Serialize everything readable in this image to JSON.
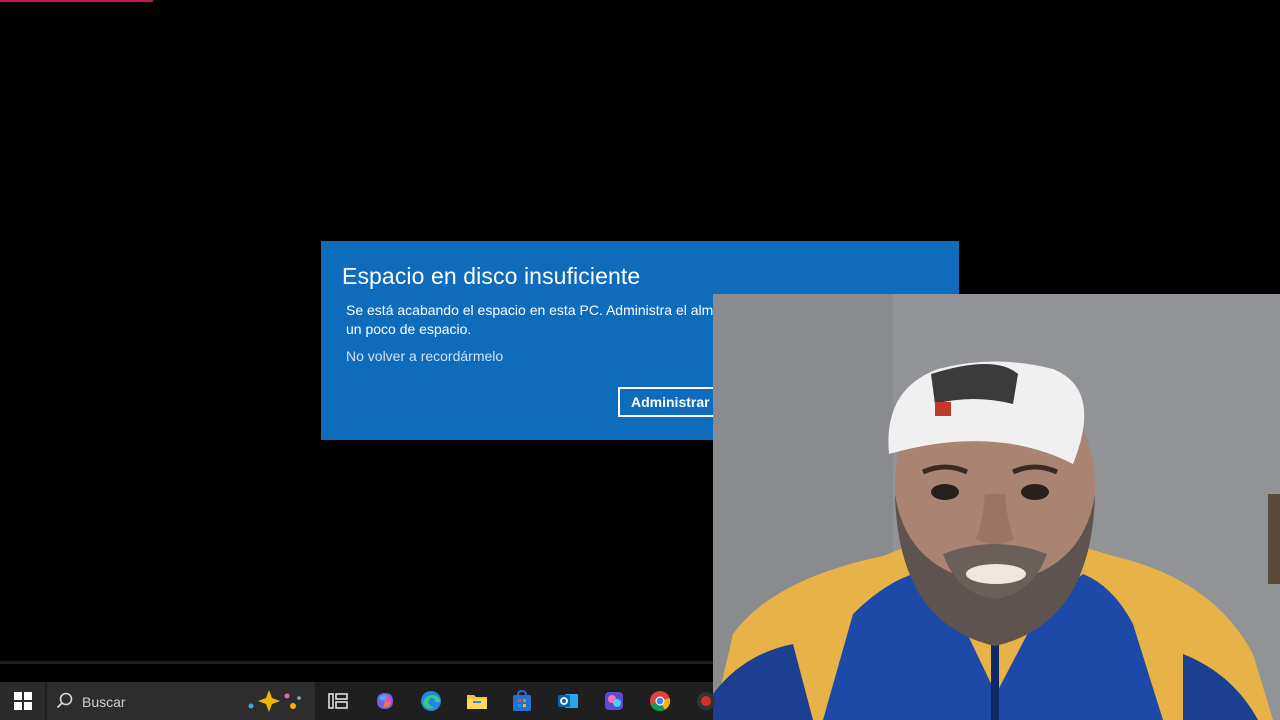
{
  "dialog": {
    "title": "Espacio en disco insuficiente",
    "body_line1": "Se está acabando el espacio en esta PC. Administra el almace",
    "body_line2": "un poco de espacio.",
    "dismiss_link": "No volver a recordármelo",
    "primary_button": "Administrar a"
  },
  "taskbar": {
    "search_placeholder": "Buscar",
    "icons": [
      "windows-start-icon",
      "search-icon",
      "copilot-sparkle-icon",
      "task-view-icon",
      "copilot-icon",
      "edge-icon",
      "file-explorer-icon",
      "microsoft-store-icon",
      "outlook-icon",
      "photo-app-icon",
      "chrome-icon",
      "app-icon"
    ]
  },
  "colors": {
    "dialog_bg": "#0f6cbd",
    "taskbar_bg": "#1f1f1f",
    "desktop_bg": "#000000"
  }
}
